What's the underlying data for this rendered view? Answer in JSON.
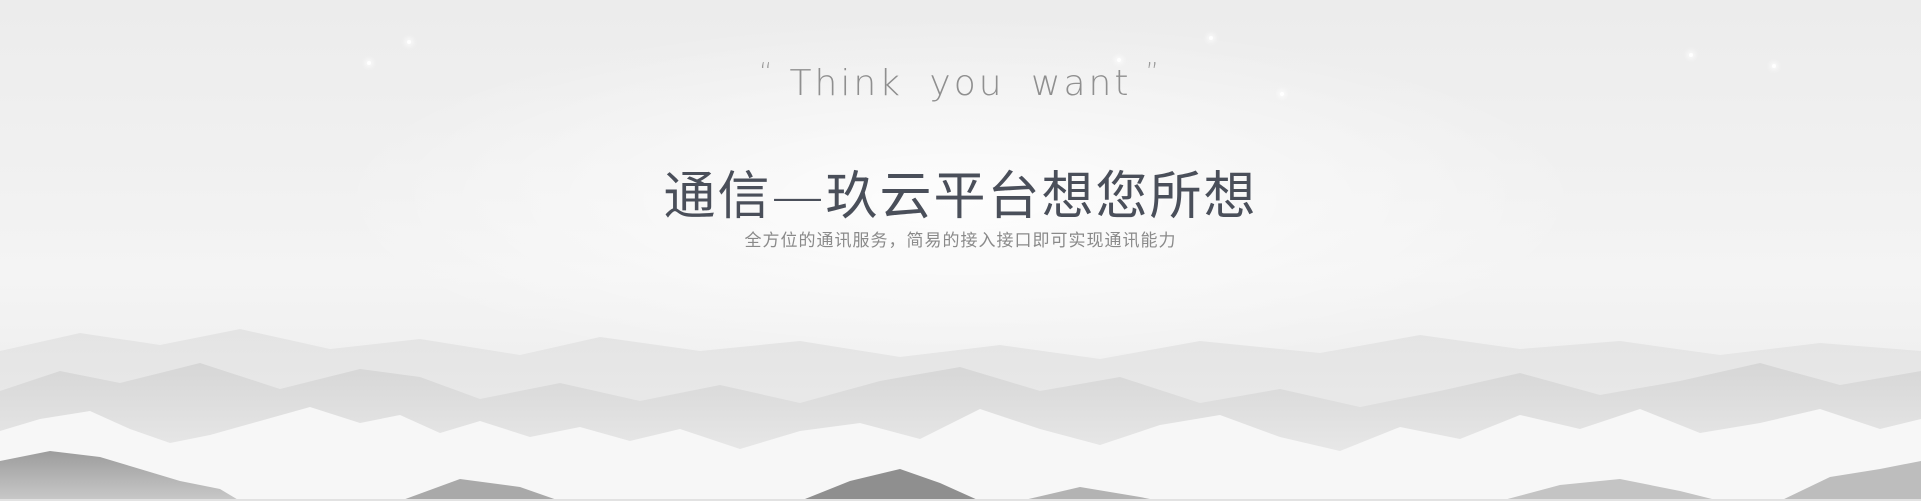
{
  "banner": {
    "slogan_open_quote": "“",
    "slogan": "Think you want",
    "slogan_close_quote": "”",
    "headline": "通信—玖云平台想您所想",
    "subline": "全方位的通讯服务，简易的接入接口即可实现通讯能力"
  },
  "theme": {
    "text_primary": "#4a4f5a",
    "text_secondary": "#8a8a8a",
    "background": "#f0f0f0"
  },
  "decor": {
    "background_image": "snowy-mountains-image"
  }
}
